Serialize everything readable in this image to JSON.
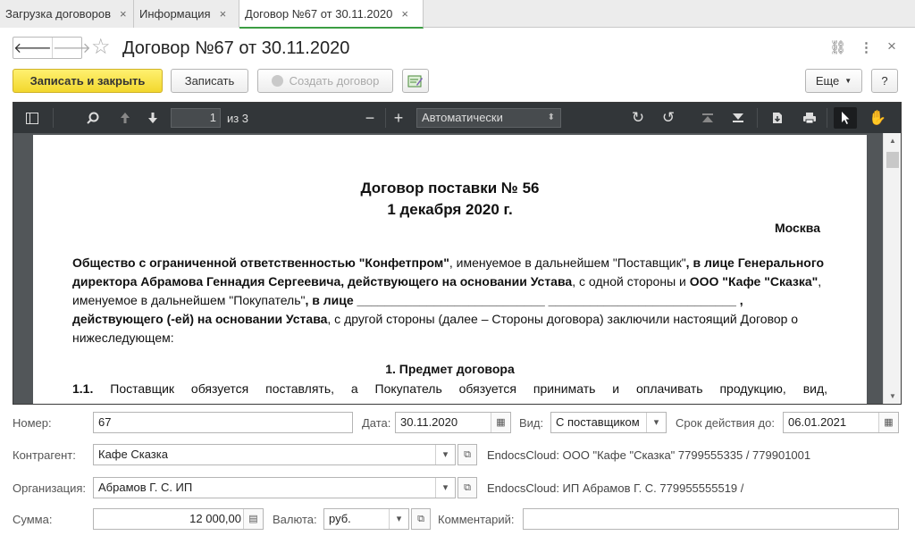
{
  "tabs": [
    {
      "label": "Загрузка договоров",
      "close": "×"
    },
    {
      "label": "Информация",
      "close": "×"
    },
    {
      "label": "Договор №67 от 30.11.2020",
      "close": "×"
    }
  ],
  "window": {
    "title": "Договор №67 от 30.11.2020",
    "nav_back": "🡐",
    "nav_forward": "🡒",
    "star": "☆",
    "link_icon": "⛓",
    "more_icon": "⋮",
    "close_icon": "×"
  },
  "toolbar": {
    "save_close": "Записать и закрыть",
    "save": "Записать",
    "create": "Создать договор",
    "more": "Еще",
    "help": "?"
  },
  "pdf_viewer": {
    "page_current": "1",
    "page_total": "из 3",
    "zoom": "Автоматически",
    "minus": "−",
    "plus": "+"
  },
  "document": {
    "title_line1": "Договор поставки № 56",
    "title_line2": "1 декабря 2020 г.",
    "city": "Москва",
    "p1_a": "Общество с ограниченной ответственностью \"Конфетпром\"",
    "p1_b": ", именуемое в дальнейшем \"Поставщик\"",
    "p1_c": ", в лице Генерального директора Абрамова Геннадия Сергеевича, действующего на основании Устава",
    "p1_d": ", с одной стороны и ",
    "p1_e": "ООО \"Кафе \"Сказка\"",
    "p1_f": ", именуемое в дальнейшем \"Покупатель\"",
    "p1_g": ", в лице ___________________________ ___________________________ , действующего (-ей) на основании Устава",
    "p1_h": ", с другой стороны (далее – Стороны договора) заключили настоящий Договор о нижеследующем:",
    "section_1": "1. Предмет договора",
    "item_1_1_num": "1.1.",
    "item_1_1_text": "Поставщик обязуется поставлять, а Покупатель обязуется принимать и оплачивать продукцию, вид,"
  },
  "form": {
    "number_label": "Номер:",
    "number_value": "67",
    "date_label": "Дата:",
    "date_value": "30.11.2020",
    "kind_label": "Вид:",
    "kind_value": "С поставщиком",
    "term_label": "Срок действия до:",
    "term_value": "06.01.2021",
    "counterparty_label": "Контрагент:",
    "counterparty_value": "Кафе Сказка",
    "counterparty_info": "EndocsCloud: ООО \"Кафе \"Сказка\" 7799555335 / 779901001",
    "org_label": "Организация:",
    "org_value": "Абрамов Г. С. ИП",
    "org_info": "EndocsCloud: ИП Абрамов Г. С. 779955555519 /",
    "sum_label": "Сумма:",
    "sum_value": "12 000,00",
    "currency_label": "Валюта:",
    "currency_value": "руб.",
    "comment_label": "Комментарий:",
    "comment_value": ""
  }
}
